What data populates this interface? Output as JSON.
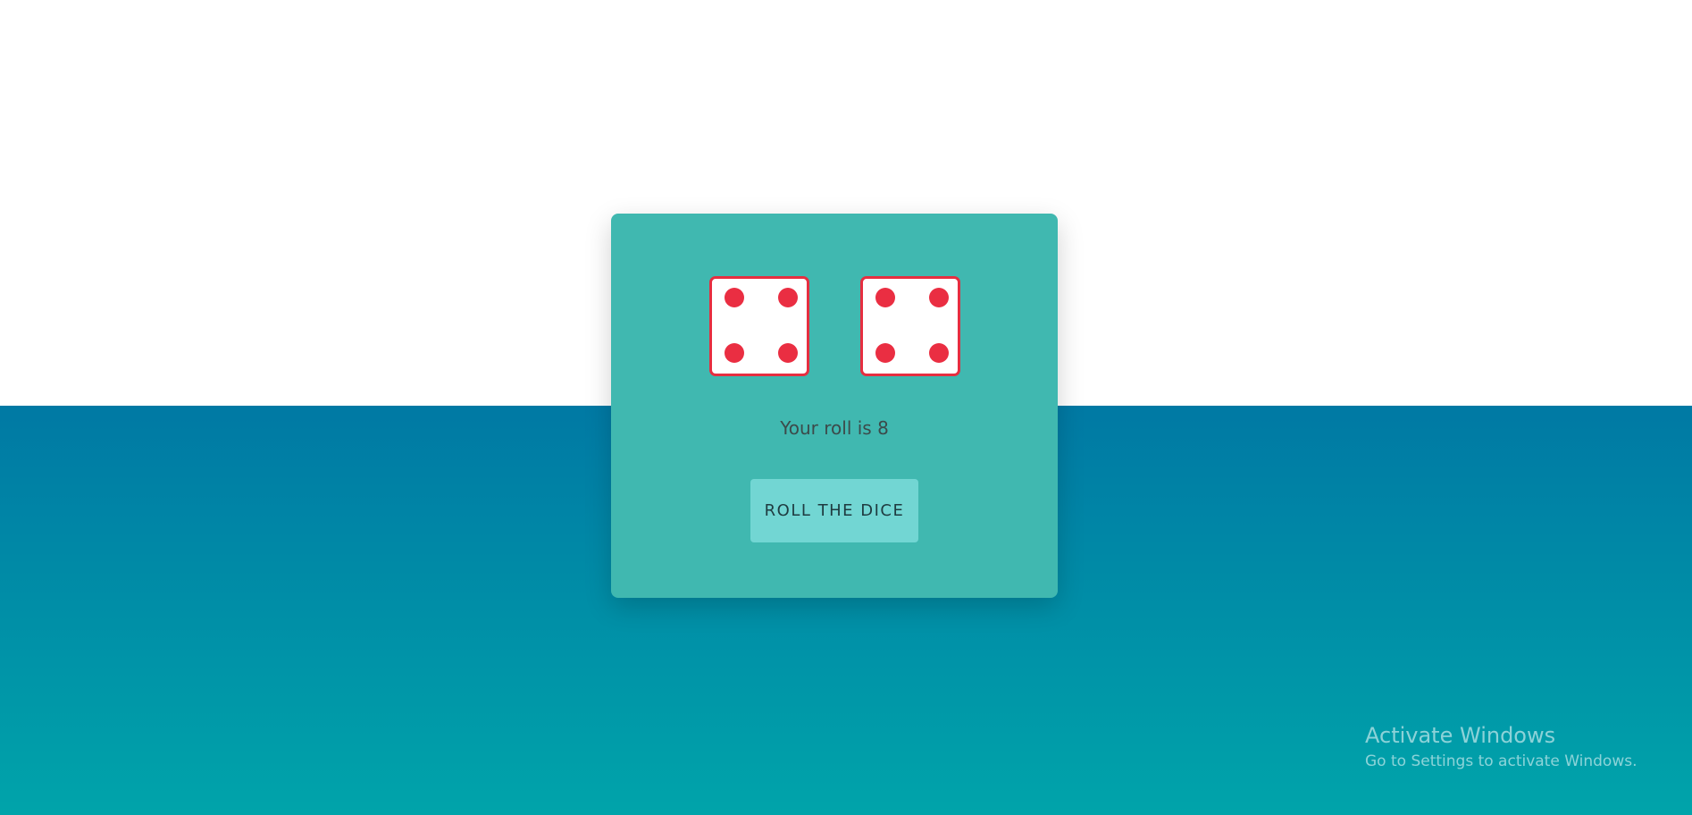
{
  "dice": {
    "left_value": 4,
    "right_value": 4,
    "pip_color": "#ea2e42",
    "border_color": "#e62e40"
  },
  "result": {
    "text": "Your roll is 8"
  },
  "button": {
    "label": "ROLL THE DICE"
  },
  "watermark": {
    "title": "Activate Windows",
    "subtitle": "Go to Settings to activate Windows."
  },
  "colors": {
    "card": "#40b8b0",
    "button": "#72d6d3",
    "band_top": "#0079a4",
    "band_bottom": "#00a4aa"
  }
}
